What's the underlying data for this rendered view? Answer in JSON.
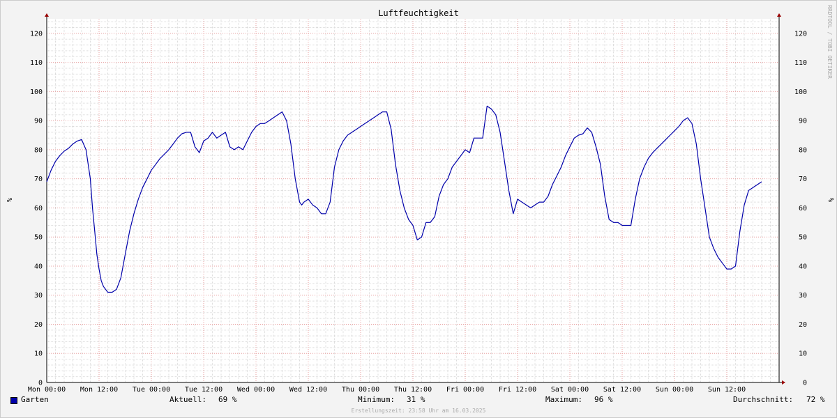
{
  "chart_data": {
    "type": "line",
    "title": "Luftfeuchtigkeit",
    "ylabel": "%",
    "ylim": [
      0,
      125
    ],
    "y_ticks": [
      0,
      10,
      20,
      30,
      40,
      50,
      60,
      70,
      80,
      90,
      100,
      110,
      120
    ],
    "x_ticks": [
      "Mon 00:00",
      "Mon 12:00",
      "Tue 00:00",
      "Tue 12:00",
      "Wed 00:00",
      "Wed 12:00",
      "Thu 00:00",
      "Thu 12:00",
      "Fri 00:00",
      "Fri 12:00",
      "Sat 00:00",
      "Sat 12:00",
      "Sun 00:00",
      "Sun 12:00"
    ],
    "x_hours_range": [
      0,
      168
    ],
    "grid": true,
    "right_axis": true,
    "series": [
      {
        "name": "Garten",
        "color": "#0000aa",
        "x_hours": [
          0,
          1,
          2,
          3,
          4,
          5,
          6,
          7,
          8,
          9,
          10,
          10.5,
          11,
          11.5,
          12,
          12.5,
          13,
          14,
          15,
          16,
          17,
          18,
          19,
          20,
          21,
          22,
          23,
          24,
          25,
          26,
          27,
          28,
          29,
          30,
          31,
          32,
          33,
          34,
          35,
          36,
          37,
          38,
          39,
          40,
          41,
          42,
          43,
          44,
          45,
          46,
          47,
          48,
          49,
          50,
          51,
          52,
          53,
          54,
          55,
          56,
          57,
          58,
          58.5,
          59,
          60,
          61,
          62,
          63,
          64,
          65,
          66,
          67,
          68,
          69,
          70,
          71,
          72,
          73,
          74,
          75,
          76,
          77,
          78,
          79,
          80,
          81,
          82,
          83,
          84,
          85,
          86,
          87,
          88,
          89,
          90,
          91,
          92,
          93,
          94,
          95,
          96,
          97,
          98,
          99,
          100,
          101,
          102,
          103,
          104,
          105,
          106,
          107,
          108,
          109,
          110,
          111,
          112,
          113,
          114,
          115,
          116,
          117,
          118,
          119,
          120,
          121,
          122,
          123,
          124,
          125,
          126,
          127,
          128,
          129,
          130,
          131,
          132,
          133,
          134,
          135,
          136,
          137,
          138,
          139,
          140,
          141,
          142,
          143,
          144,
          145,
          146,
          147,
          148,
          149,
          150,
          151,
          152,
          153,
          154,
          155,
          156,
          157,
          158,
          159,
          160,
          161,
          162,
          163,
          164,
          165,
          166,
          167,
          168
        ],
        "values": [
          69,
          73,
          76,
          78,
          79.5,
          80.5,
          82,
          83,
          83.5,
          80,
          70,
          60,
          52,
          44,
          39,
          35,
          33,
          31,
          31,
          32,
          36,
          44,
          52,
          58,
          63,
          67,
          70,
          73,
          75,
          77,
          78.5,
          80,
          82,
          84,
          85.5,
          86,
          86,
          81,
          79,
          83,
          84,
          86,
          84,
          85,
          86,
          81,
          80,
          81,
          80,
          83,
          86,
          88,
          89,
          89,
          90,
          91,
          92,
          93,
          90,
          82,
          70,
          62,
          61,
          62,
          63,
          61,
          60,
          58,
          58,
          62,
          74,
          80,
          83,
          85,
          86,
          87,
          88,
          89,
          90,
          91,
          92,
          93,
          93,
          87,
          75,
          66,
          60,
          56,
          54,
          49,
          50,
          55,
          55,
          57,
          64,
          68,
          70,
          74,
          76,
          78,
          80,
          79,
          84,
          84,
          84,
          95,
          94,
          92,
          86,
          76,
          66,
          58,
          63,
          62,
          61,
          60,
          61,
          62,
          62,
          64,
          68,
          71,
          74,
          78,
          81,
          84,
          85,
          85.5,
          87.5,
          86,
          81,
          75,
          64,
          56,
          55,
          55,
          54,
          54,
          54,
          63,
          70,
          74,
          77,
          79,
          80.5,
          82,
          83.5,
          85,
          86.5,
          88,
          90,
          91,
          89,
          82,
          70,
          60,
          50,
          46,
          43,
          41,
          39,
          39,
          40,
          52,
          61,
          66,
          67,
          68,
          69
        ]
      }
    ]
  },
  "side_text": "RRDTOOL / TOBI OETIKER",
  "legend": {
    "series_name": "Garten",
    "current_label": "Aktuell:",
    "current_value": "69 %",
    "min_label": "Minimum:",
    "min_value": "31 %",
    "max_label": "Maximum:",
    "max_value": "96 %",
    "avg_label": "Durchschnitt:",
    "avg_value": "72 %"
  },
  "footer": "Erstellungszeit: 23:58 Uhr am 16.03.2025"
}
